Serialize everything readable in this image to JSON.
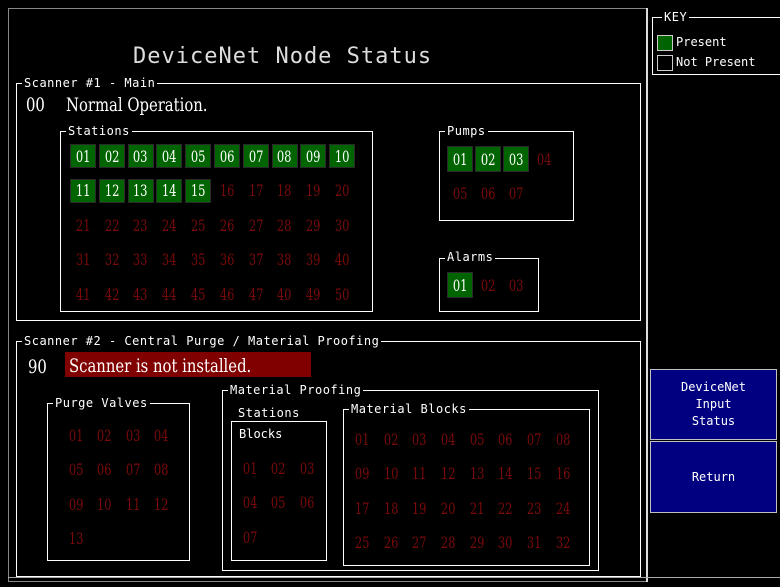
{
  "title": "DeviceNet Node Status",
  "key": {
    "label": "KEY",
    "present": "Present",
    "not_present": "Not Present",
    "colors": {
      "present": "#006400",
      "not_present": "#000000",
      "absent_text": "#7a0a0a"
    }
  },
  "scanner1": {
    "label": "Scanner #1 - Main",
    "code": "00",
    "status": "Normal Operation.",
    "stations": {
      "label": "Stations",
      "nodes": [
        {
          "n": "01",
          "p": true
        },
        {
          "n": "02",
          "p": true
        },
        {
          "n": "03",
          "p": true
        },
        {
          "n": "04",
          "p": true
        },
        {
          "n": "05",
          "p": true
        },
        {
          "n": "06",
          "p": true
        },
        {
          "n": "07",
          "p": true
        },
        {
          "n": "08",
          "p": true
        },
        {
          "n": "09",
          "p": true
        },
        {
          "n": "10",
          "p": true
        },
        {
          "n": "11",
          "p": true
        },
        {
          "n": "12",
          "p": true
        },
        {
          "n": "13",
          "p": true
        },
        {
          "n": "14",
          "p": true
        },
        {
          "n": "15",
          "p": true
        },
        {
          "n": "16",
          "p": false
        },
        {
          "n": "17",
          "p": false
        },
        {
          "n": "18",
          "p": false
        },
        {
          "n": "19",
          "p": false
        },
        {
          "n": "20",
          "p": false
        },
        {
          "n": "21",
          "p": false
        },
        {
          "n": "22",
          "p": false
        },
        {
          "n": "23",
          "p": false
        },
        {
          "n": "24",
          "p": false
        },
        {
          "n": "25",
          "p": false
        },
        {
          "n": "26",
          "p": false
        },
        {
          "n": "27",
          "p": false
        },
        {
          "n": "28",
          "p": false
        },
        {
          "n": "29",
          "p": false
        },
        {
          "n": "30",
          "p": false
        },
        {
          "n": "31",
          "p": false
        },
        {
          "n": "32",
          "p": false
        },
        {
          "n": "33",
          "p": false
        },
        {
          "n": "34",
          "p": false
        },
        {
          "n": "35",
          "p": false
        },
        {
          "n": "36",
          "p": false
        },
        {
          "n": "37",
          "p": false
        },
        {
          "n": "38",
          "p": false
        },
        {
          "n": "39",
          "p": false
        },
        {
          "n": "40",
          "p": false
        },
        {
          "n": "41",
          "p": false
        },
        {
          "n": "42",
          "p": false
        },
        {
          "n": "43",
          "p": false
        },
        {
          "n": "44",
          "p": false
        },
        {
          "n": "45",
          "p": false
        },
        {
          "n": "46",
          "p": false
        },
        {
          "n": "47",
          "p": false
        },
        {
          "n": "40",
          "p": false
        },
        {
          "n": "49",
          "p": false
        },
        {
          "n": "50",
          "p": false
        }
      ]
    },
    "pumps": {
      "label": "Pumps",
      "nodes": [
        {
          "n": "01",
          "p": true
        },
        {
          "n": "02",
          "p": true
        },
        {
          "n": "03",
          "p": true
        },
        {
          "n": "04",
          "p": false
        },
        {
          "n": "05",
          "p": false
        },
        {
          "n": "06",
          "p": false
        },
        {
          "n": "07",
          "p": false
        }
      ]
    },
    "alarms": {
      "label": "Alarms",
      "nodes": [
        {
          "n": "01",
          "p": true
        },
        {
          "n": "02",
          "p": false
        },
        {
          "n": "03",
          "p": false
        }
      ]
    }
  },
  "scanner2": {
    "label": "Scanner #2 - Central Purge / Material Proofing",
    "code": "90",
    "status": "Scanner is not installed.",
    "status_bg": "#800000",
    "purge_valves": {
      "label": "Purge Valves",
      "nodes": [
        "01",
        "02",
        "03",
        "04",
        "05",
        "06",
        "07",
        "08",
        "09",
        "10",
        "11",
        "12",
        "13"
      ]
    },
    "material_proofing": {
      "label": "Material Proofing",
      "stations_blocks": {
        "label_line1": "Stations",
        "label_line2": "Blocks",
        "nodes": [
          "01",
          "02",
          "03",
          "04",
          "05",
          "06",
          "07"
        ]
      },
      "material_blocks": {
        "label": "Material Blocks",
        "nodes": [
          "01",
          "02",
          "03",
          "04",
          "05",
          "06",
          "07",
          "08",
          "09",
          "10",
          "11",
          "12",
          "13",
          "14",
          "15",
          "16",
          "17",
          "18",
          "19",
          "20",
          "21",
          "22",
          "23",
          "24",
          "25",
          "26",
          "27",
          "28",
          "29",
          "30",
          "31",
          "32"
        ]
      }
    }
  },
  "buttons": {
    "input_status_line1": "DeviceNet",
    "input_status_line2": "Input",
    "input_status_line3": "Status",
    "return": "Return"
  }
}
